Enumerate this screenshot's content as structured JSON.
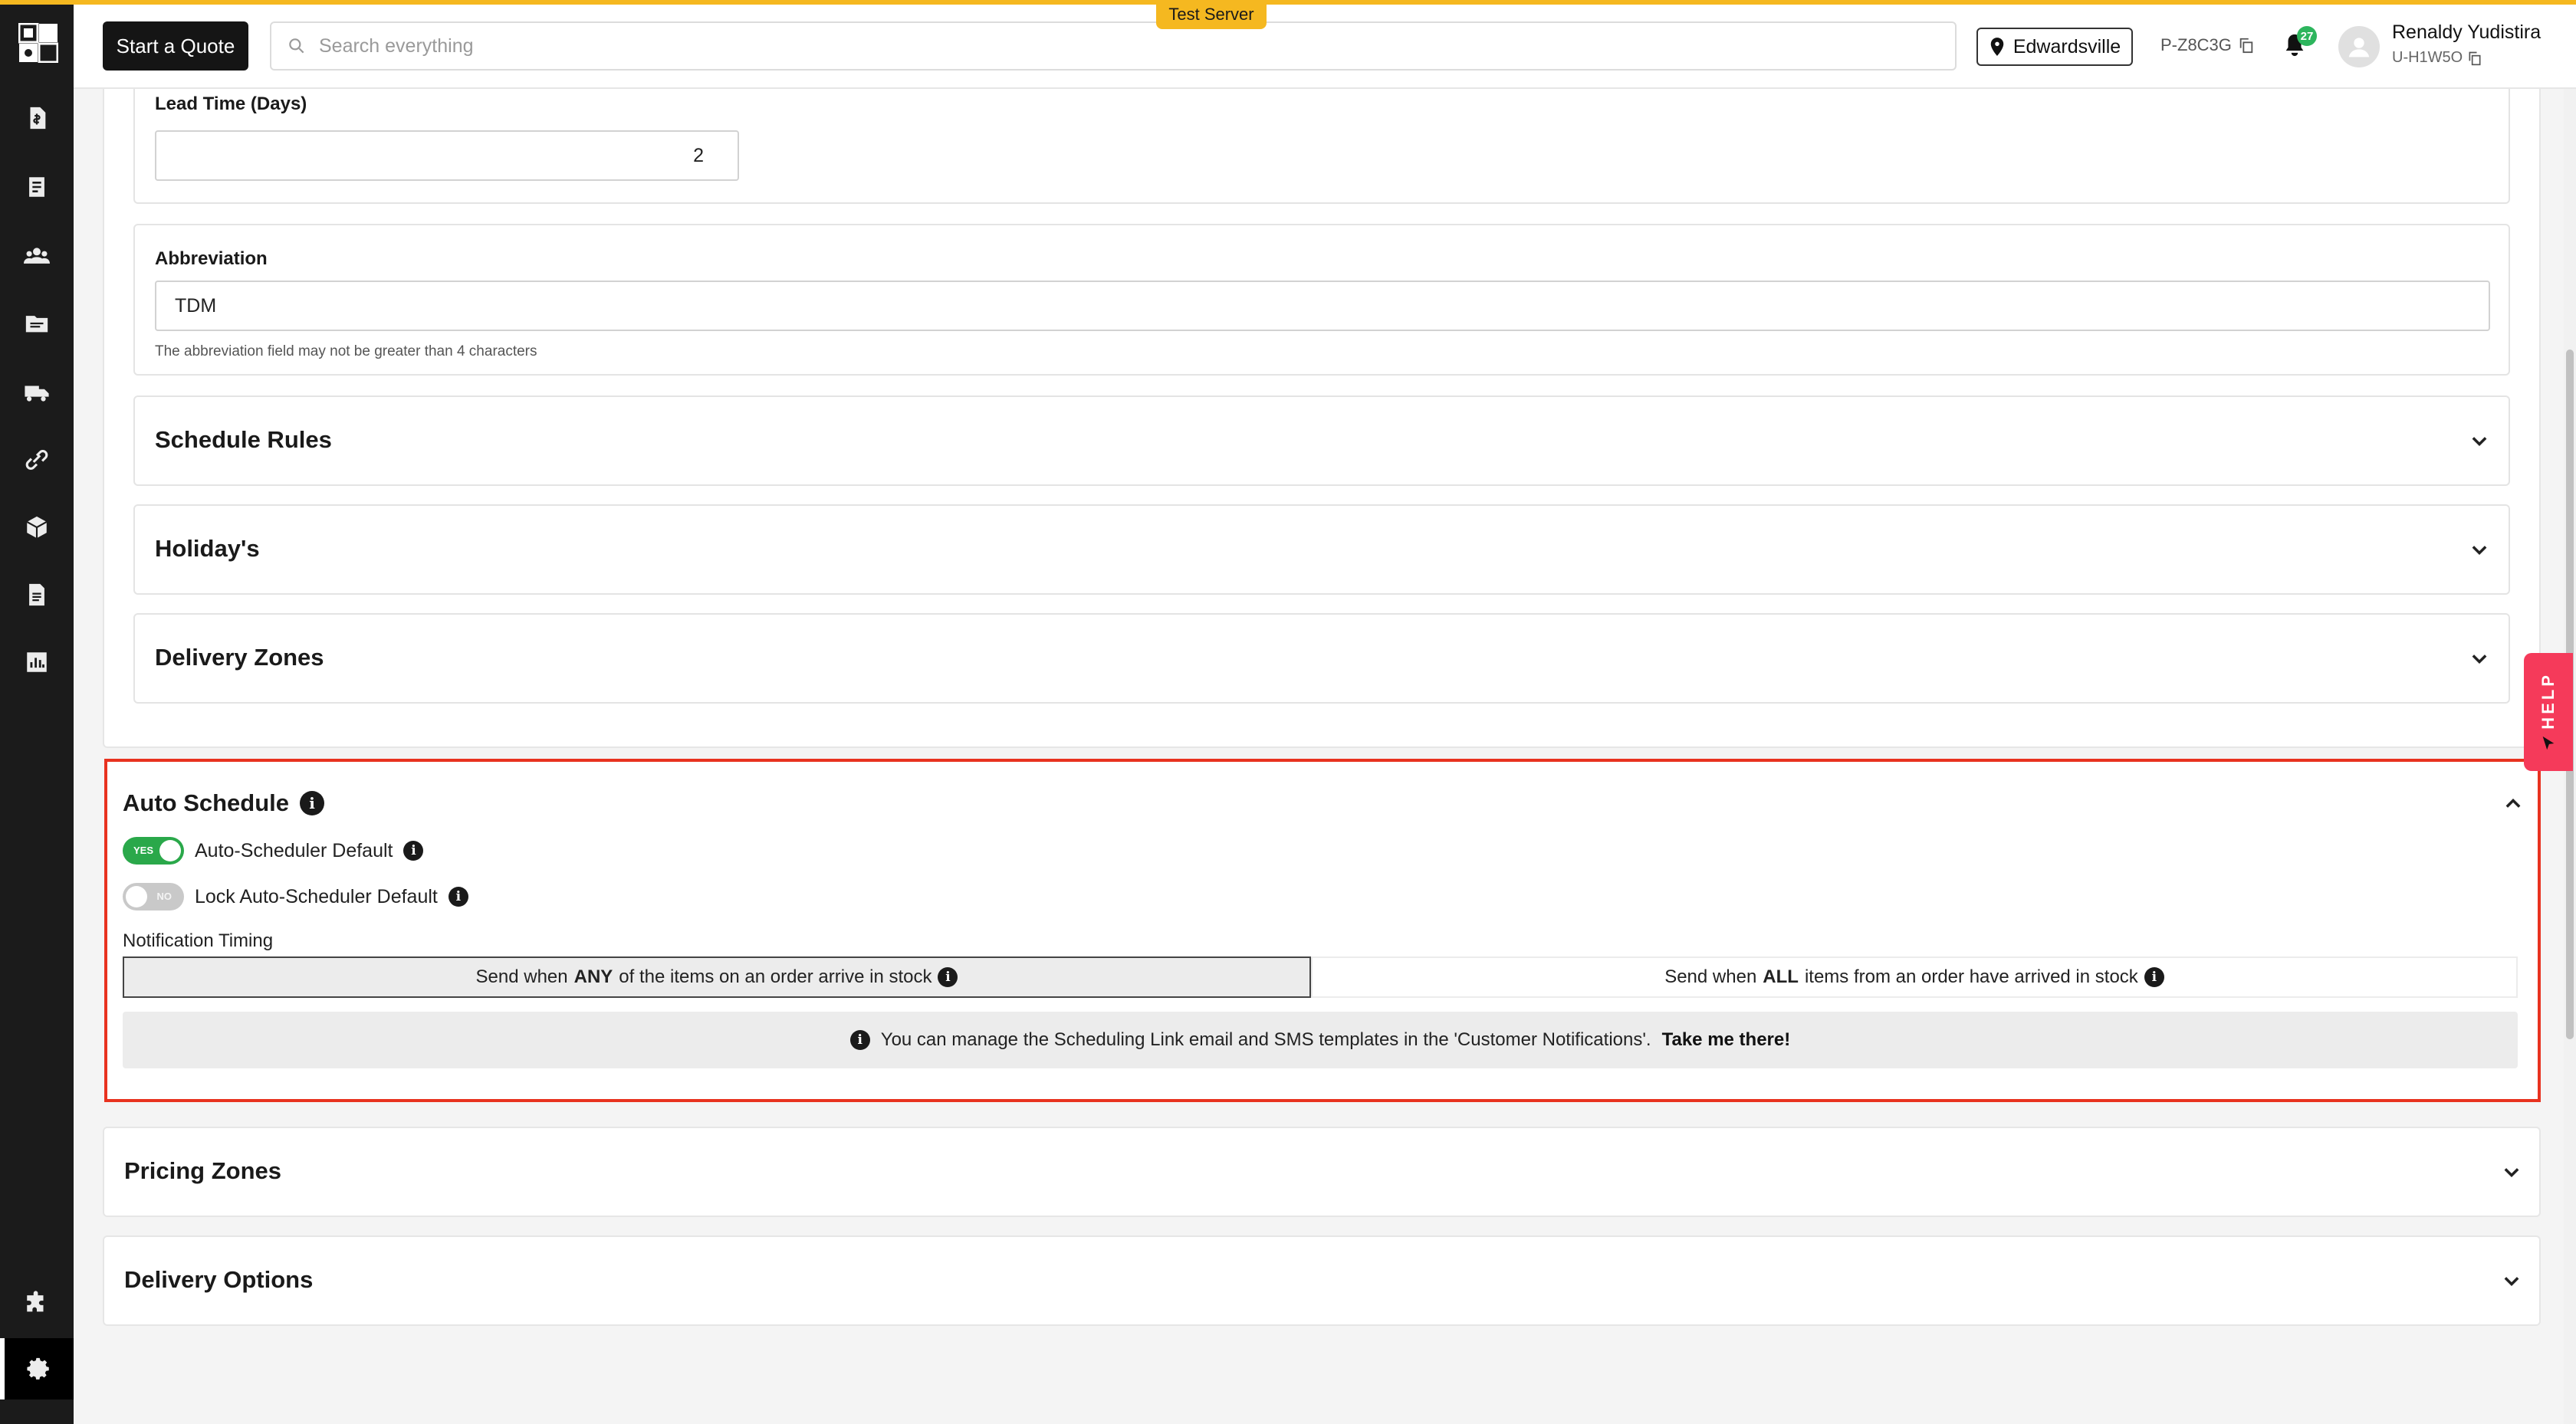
{
  "header": {
    "start_quote_label": "Start a Quote",
    "search_placeholder": "Search everything",
    "server_badge": "Test Server",
    "location": "Edwardsville",
    "store_id": "P-Z8C3G",
    "notification_count": "27",
    "user_name": "Renaldy Yudistira",
    "user_id": "U-H1W5O"
  },
  "sidebar": {
    "items": [
      "quotes-icon",
      "orders-icon",
      "customers-icon",
      "files-icon",
      "delivery-truck-icon",
      "integrations-icon",
      "products-icon",
      "documents-icon",
      "reports-icon",
      "plugins-icon",
      "settings-icon"
    ],
    "active": "settings-icon"
  },
  "form": {
    "lead_time_label": "Lead Time (Days)",
    "lead_time_value": "2",
    "abbreviation_label": "Abbreviation",
    "abbreviation_value": "TDM",
    "abbreviation_helper": "The abbreviation field may not be greater than 4 characters"
  },
  "sections": {
    "schedule_rules": "Schedule Rules",
    "holidays": "Holiday's",
    "delivery_zones": "Delivery Zones",
    "pricing_zones": "Pricing Zones",
    "delivery_options": "Delivery Options"
  },
  "auto_schedule": {
    "title": "Auto Schedule",
    "default_label": "Auto-Scheduler Default",
    "default_on": true,
    "default_state_text": "YES",
    "lock_label": "Lock Auto-Scheduler Default",
    "lock_on": false,
    "lock_state_text": "NO",
    "notification_timing_label": "Notification Timing",
    "option_any_pre": "Send when",
    "option_any_bold": "ANY",
    "option_any_post": "of the items on an order arrive in stock",
    "option_all_pre": "Send when",
    "option_all_bold": "ALL",
    "option_all_post": "items from an order have arrived in stock",
    "selected_option": "any",
    "notice_text": "You can manage the Scheduling Link email and SMS templates in the 'Customer Notifications'.",
    "notice_link": "Take me there!"
  },
  "help_tab": "HELP",
  "colors": {
    "accent": "#f5b820",
    "highlight_border": "#e8321f",
    "toggle_on": "#2aa84a",
    "help": "#f53a5a"
  }
}
